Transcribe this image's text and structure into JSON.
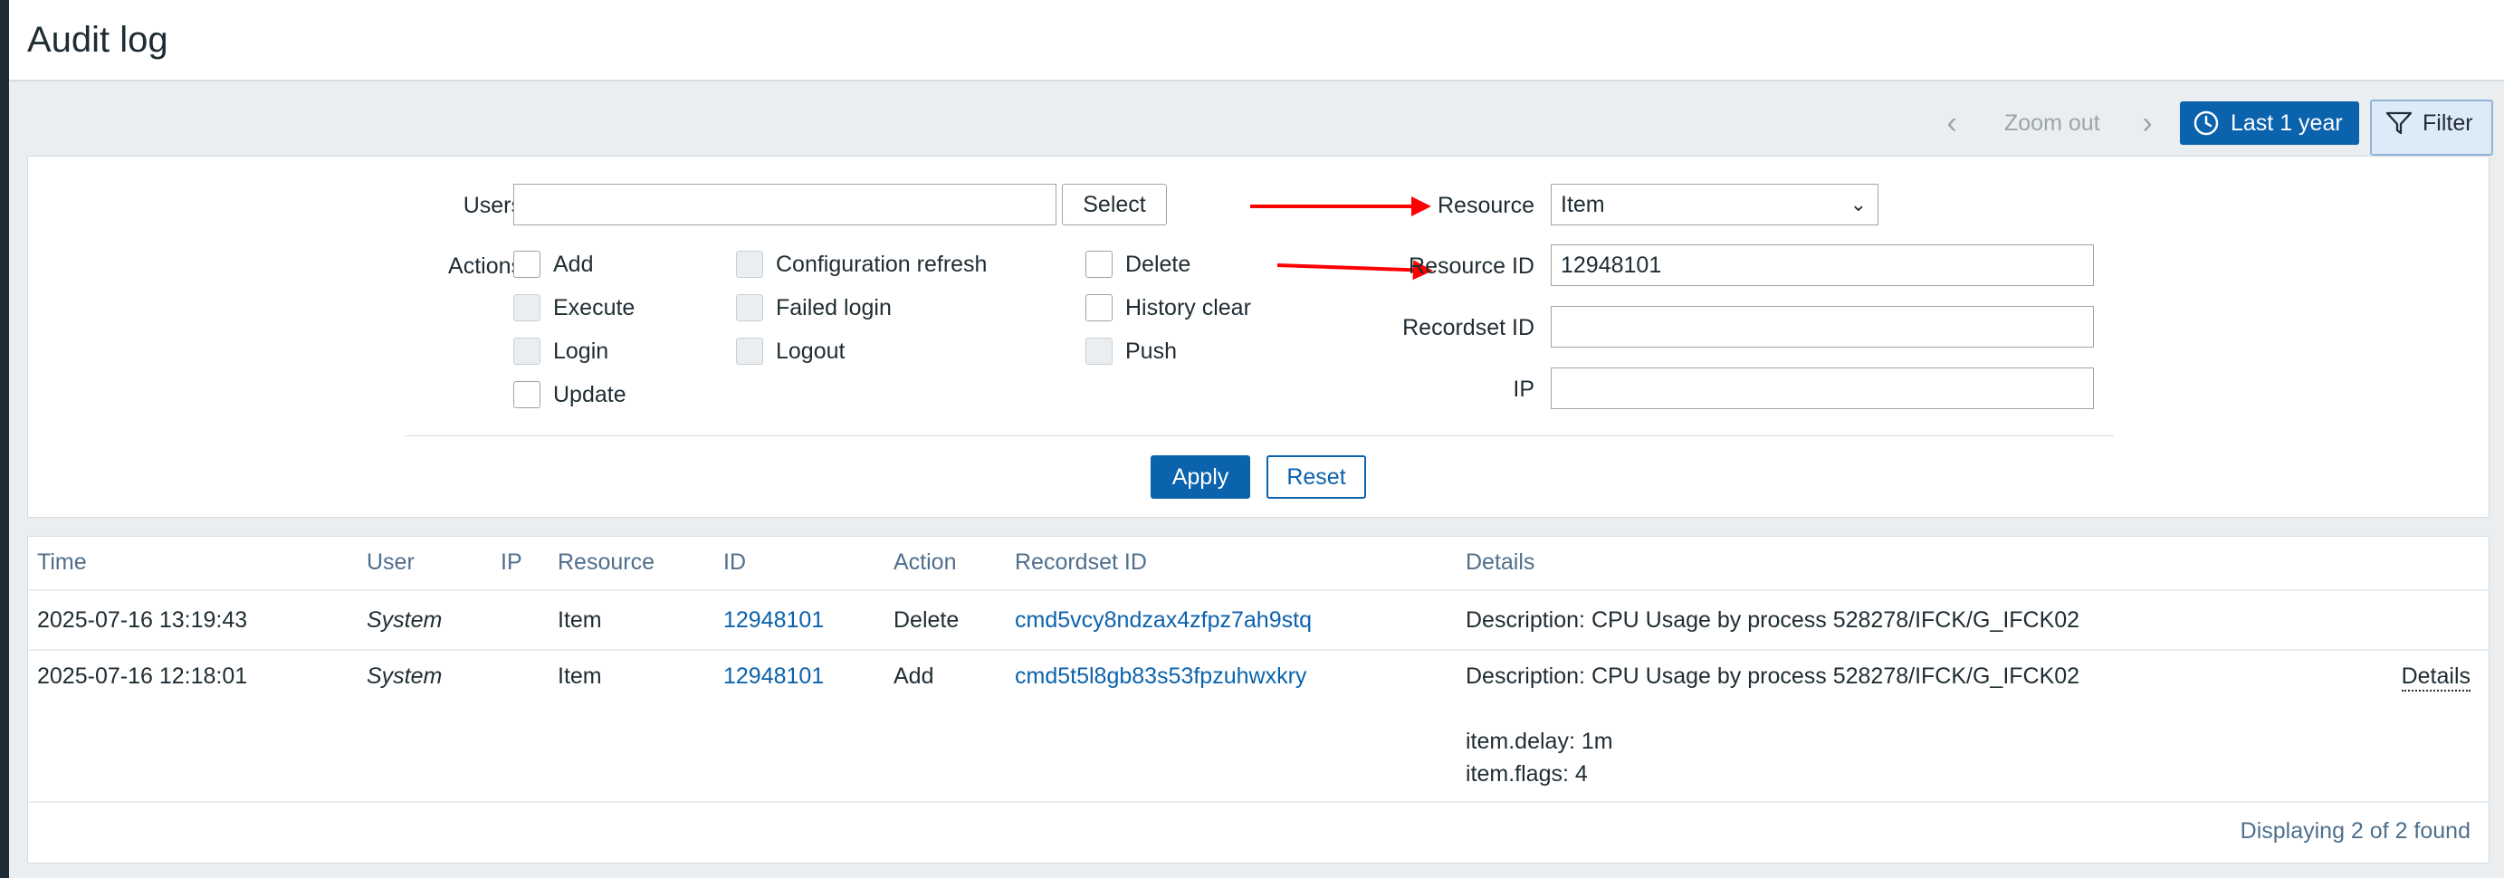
{
  "page": {
    "title": "Audit log"
  },
  "timebar": {
    "zoom_out_label": "Zoom out",
    "period_label": "Last 1 year",
    "filter_label": "Filter"
  },
  "filter": {
    "users_label": "Users",
    "users_value": "",
    "select_button": "Select",
    "actions_label": "Actions",
    "actions": [
      {
        "label": "Add",
        "checked": false,
        "enabled": true
      },
      {
        "label": "Configuration refresh",
        "checked": false,
        "enabled": false
      },
      {
        "label": "Delete",
        "checked": false,
        "enabled": true
      },
      {
        "label": "Execute",
        "checked": false,
        "enabled": false
      },
      {
        "label": "Failed login",
        "checked": false,
        "enabled": false
      },
      {
        "label": "History clear",
        "checked": false,
        "enabled": true
      },
      {
        "label": "Login",
        "checked": false,
        "enabled": false
      },
      {
        "label": "Logout",
        "checked": false,
        "enabled": false
      },
      {
        "label": "Push",
        "checked": false,
        "enabled": false
      },
      {
        "label": "Update",
        "checked": false,
        "enabled": true
      }
    ],
    "resource_label": "Resource",
    "resource_value": "Item",
    "resource_id_label": "Resource ID",
    "resource_id_value": "12948101",
    "recordset_id_label": "Recordset ID",
    "recordset_id_value": "",
    "ip_label": "IP",
    "ip_value": "",
    "apply_button": "Apply",
    "reset_button": "Reset"
  },
  "table": {
    "columns": [
      "Time",
      "User",
      "IP",
      "Resource",
      "ID",
      "Action",
      "Recordset ID",
      "Details"
    ],
    "rows": [
      {
        "time": "2025-07-16 13:19:43",
        "user": "System",
        "ip": "",
        "resource": "Item",
        "id": "12948101",
        "action": "Delete",
        "recordset_id": "cmd5vcy8ndzax4zfpz7ah9stq",
        "details": "Description: CPU Usage by process 528278/IFCK/G_IFCK02"
      },
      {
        "time": "2025-07-16 12:18:01",
        "user": "System",
        "ip": "",
        "resource": "Item",
        "id": "12948101",
        "action": "Add",
        "recordset_id": "cmd5t5l8gb83s53fpzuhwxkry",
        "details": "Description: CPU Usage by process 528278/IFCK/G_IFCK02",
        "details_extra_1": "item.delay: 1m",
        "details_extra_2": "item.flags: 4",
        "details_link": "Details"
      }
    ],
    "footer": "Displaying 2 of 2 found"
  },
  "colors": {
    "primary": "#0b62ad",
    "annotation_arrow": "#ff0000"
  }
}
